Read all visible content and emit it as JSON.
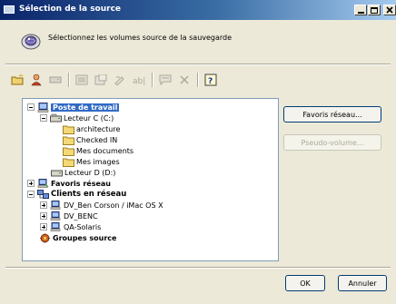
{
  "window": {
    "title": "Sélection de la source"
  },
  "header": {
    "text": "Sélectionnez les volumes source de la sauvegarde"
  },
  "toolbar": {
    "icons": [
      "new-folder-icon",
      "user-icon",
      "drive-icon",
      "list-icon",
      "properties-icon",
      "rename-icon",
      "text-icon",
      "comment-icon",
      "delete-icon",
      "help-icon"
    ]
  },
  "tree": {
    "poste": "Poste de travail",
    "lecteur_c": "Lecteur C (C:)",
    "architecture": "architecture",
    "checked_in": "Checked IN",
    "mes_documents": "Mes documents",
    "mes_images": "Mes images",
    "lecteur_d": "Lecteur D (D:)",
    "favoris": "Favoris réseau",
    "clients": "Clients en réseau",
    "client1": "DV_Ben Corson / iMac OS X",
    "client2": "DV_BENC",
    "client3": "QA-Solaris",
    "groupes": "Groupes source"
  },
  "buttons": {
    "favoris_reseau": "Favoris réseau...",
    "pseudo_volume": "Pseudo-volume...",
    "ok": "OK",
    "annuler": "Annuler"
  },
  "colors": {
    "title_start": "#0a246a",
    "title_end": "#a6caf0",
    "selection": "#316ac5",
    "dialog_bg": "#ece9d8"
  }
}
